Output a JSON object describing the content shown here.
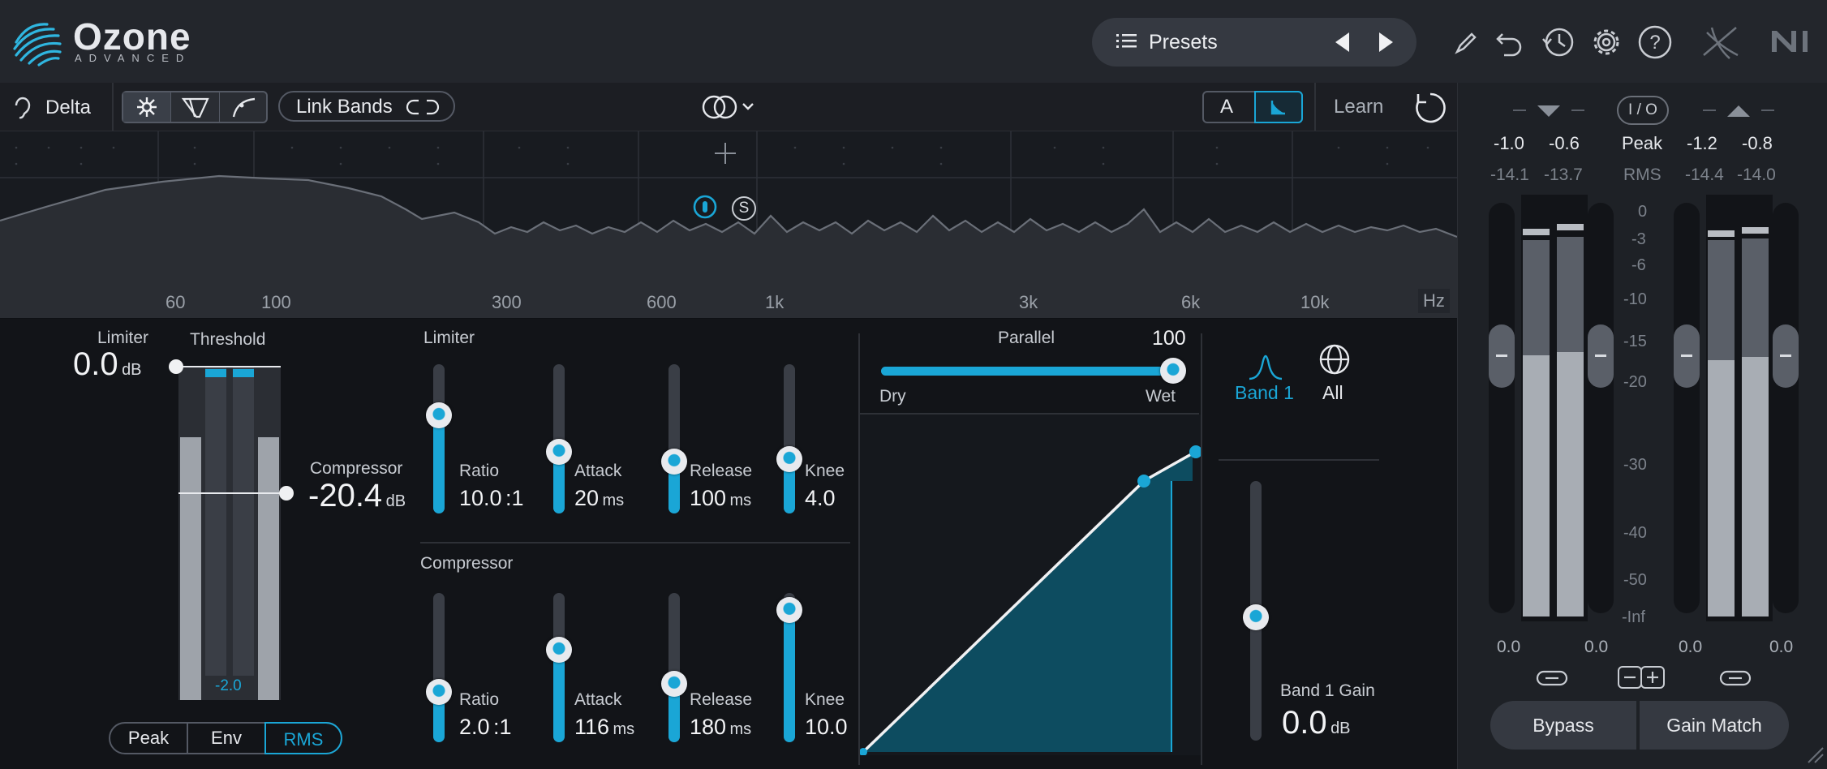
{
  "app": {
    "name": "Ozone",
    "edition": "ADVANCED"
  },
  "header": {
    "presets_label": "Presets"
  },
  "toolbar": {
    "delta_label": "Delta",
    "link_bands_label": "Link Bands",
    "ab_a_label": "A",
    "learn_label": "Learn"
  },
  "spectrum": {
    "frequency_labels": [
      "60",
      "100",
      "300",
      "600",
      "1k",
      "3k",
      "6k",
      "10k",
      "Hz"
    ],
    "band_marker_label": "S"
  },
  "threshold_section": {
    "limiter_label": "Limiter",
    "limiter_value": "0.0",
    "limiter_unit": "dB",
    "threshold_label": "Threshold",
    "compressor_label": "Compressor",
    "compressor_value": "-20.4",
    "compressor_unit": "dB",
    "meter_readout": "-2.0",
    "detection_modes": [
      "Peak",
      "Env",
      "RMS"
    ],
    "selected_mode": "RMS"
  },
  "limiter": {
    "title": "Limiter",
    "params": [
      {
        "label": "Ratio",
        "value": "10.0",
        "unit": ":1",
        "level": 0.72
      },
      {
        "label": "Attack",
        "value": "20",
        "unit": "ms",
        "level": 0.45
      },
      {
        "label": "Release",
        "value": "100",
        "unit": "ms",
        "level": 0.38
      },
      {
        "label": "Knee",
        "value": "4.0",
        "unit": "",
        "level": 0.4
      }
    ]
  },
  "compressor": {
    "title": "Compressor",
    "params": [
      {
        "label": "Ratio",
        "value": "2.0",
        "unit": ":1",
        "level": 0.37
      },
      {
        "label": "Attack",
        "value": "116",
        "unit": "ms",
        "level": 0.68
      },
      {
        "label": "Release",
        "value": "180",
        "unit": "ms",
        "level": 0.43
      },
      {
        "label": "Knee",
        "value": "10.0",
        "unit": "",
        "level": 0.97
      }
    ]
  },
  "parallel": {
    "label": "Parallel",
    "value": "100",
    "dry_label": "Dry",
    "wet_label": "Wet",
    "level": 1.0
  },
  "band_select": {
    "band1_label": "Band 1",
    "all_label": "All",
    "gain_label": "Band 1 Gain",
    "gain_value": "0.0",
    "gain_unit": "dB",
    "gain_level": 0.5
  },
  "meters": {
    "io_label": "I / O",
    "peak_label": "Peak",
    "rms_label": "RMS",
    "input_peak": [
      "-1.0",
      "-0.6"
    ],
    "input_rms": [
      "-14.1",
      "-13.7"
    ],
    "output_peak": [
      "-1.2",
      "-0.8"
    ],
    "output_rms": [
      "-14.4",
      "-14.0"
    ],
    "scale": [
      "0",
      "-3",
      "-6",
      "-10",
      "-15",
      "-20",
      "-30",
      "-40",
      "-50",
      "-Inf"
    ],
    "fader_values": [
      "0.0",
      "0.0",
      "0.0",
      "0.0"
    ],
    "bypass_label": "Bypass",
    "gain_match_label": "Gain Match"
  },
  "colors": {
    "accent": "#1aa6d6",
    "background": "#121418",
    "panel": "#1e2126"
  }
}
